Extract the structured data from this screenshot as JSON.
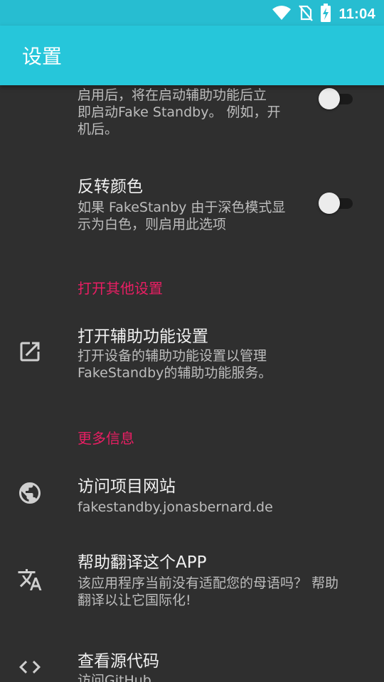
{
  "status_bar": {
    "time": "11:04",
    "icons": [
      "wifi-icon",
      "no-sim-icon",
      "battery-charging-icon"
    ]
  },
  "app_bar": {
    "title": "设置"
  },
  "prefs": {
    "start_after_accessibility": {
      "summary": "启用后，将在启动辅助功能后立\n即启动Fake Standby。 例如，开\n机后。",
      "enabled": false
    },
    "invert_colors": {
      "title": "反转颜色",
      "summary": "如果 FakeStanby 由于深色模式显\n示为白色，则启用此选项",
      "enabled": false
    }
  },
  "categories": {
    "other_settings": "打开其他设置",
    "more_info": "更多信息"
  },
  "open_accessibility": {
    "title": "打开辅助功能设置",
    "summary": "打开设备的辅助功能设置以管理\nFakeStandby的辅助功能服务。",
    "icon": "open-in-new-icon"
  },
  "visit_website": {
    "title": "访问项目网站",
    "summary": "fakestandby.jonasbernard.de",
    "icon": "globe-icon"
  },
  "help_translate": {
    "title": "帮助翻译这个APP",
    "summary": "该应用程序当前没有适配您的母语吗？ 帮助\n翻译以让它国际化!",
    "icon": "translate-icon"
  },
  "view_source": {
    "title": "查看源代码",
    "summary": "访问GitHub",
    "icon": "code-icon"
  },
  "colors": {
    "status_bar": "#27bdd1",
    "app_bar": "#26c6da",
    "background": "#2f2f2f",
    "accent": "#e91e63"
  }
}
